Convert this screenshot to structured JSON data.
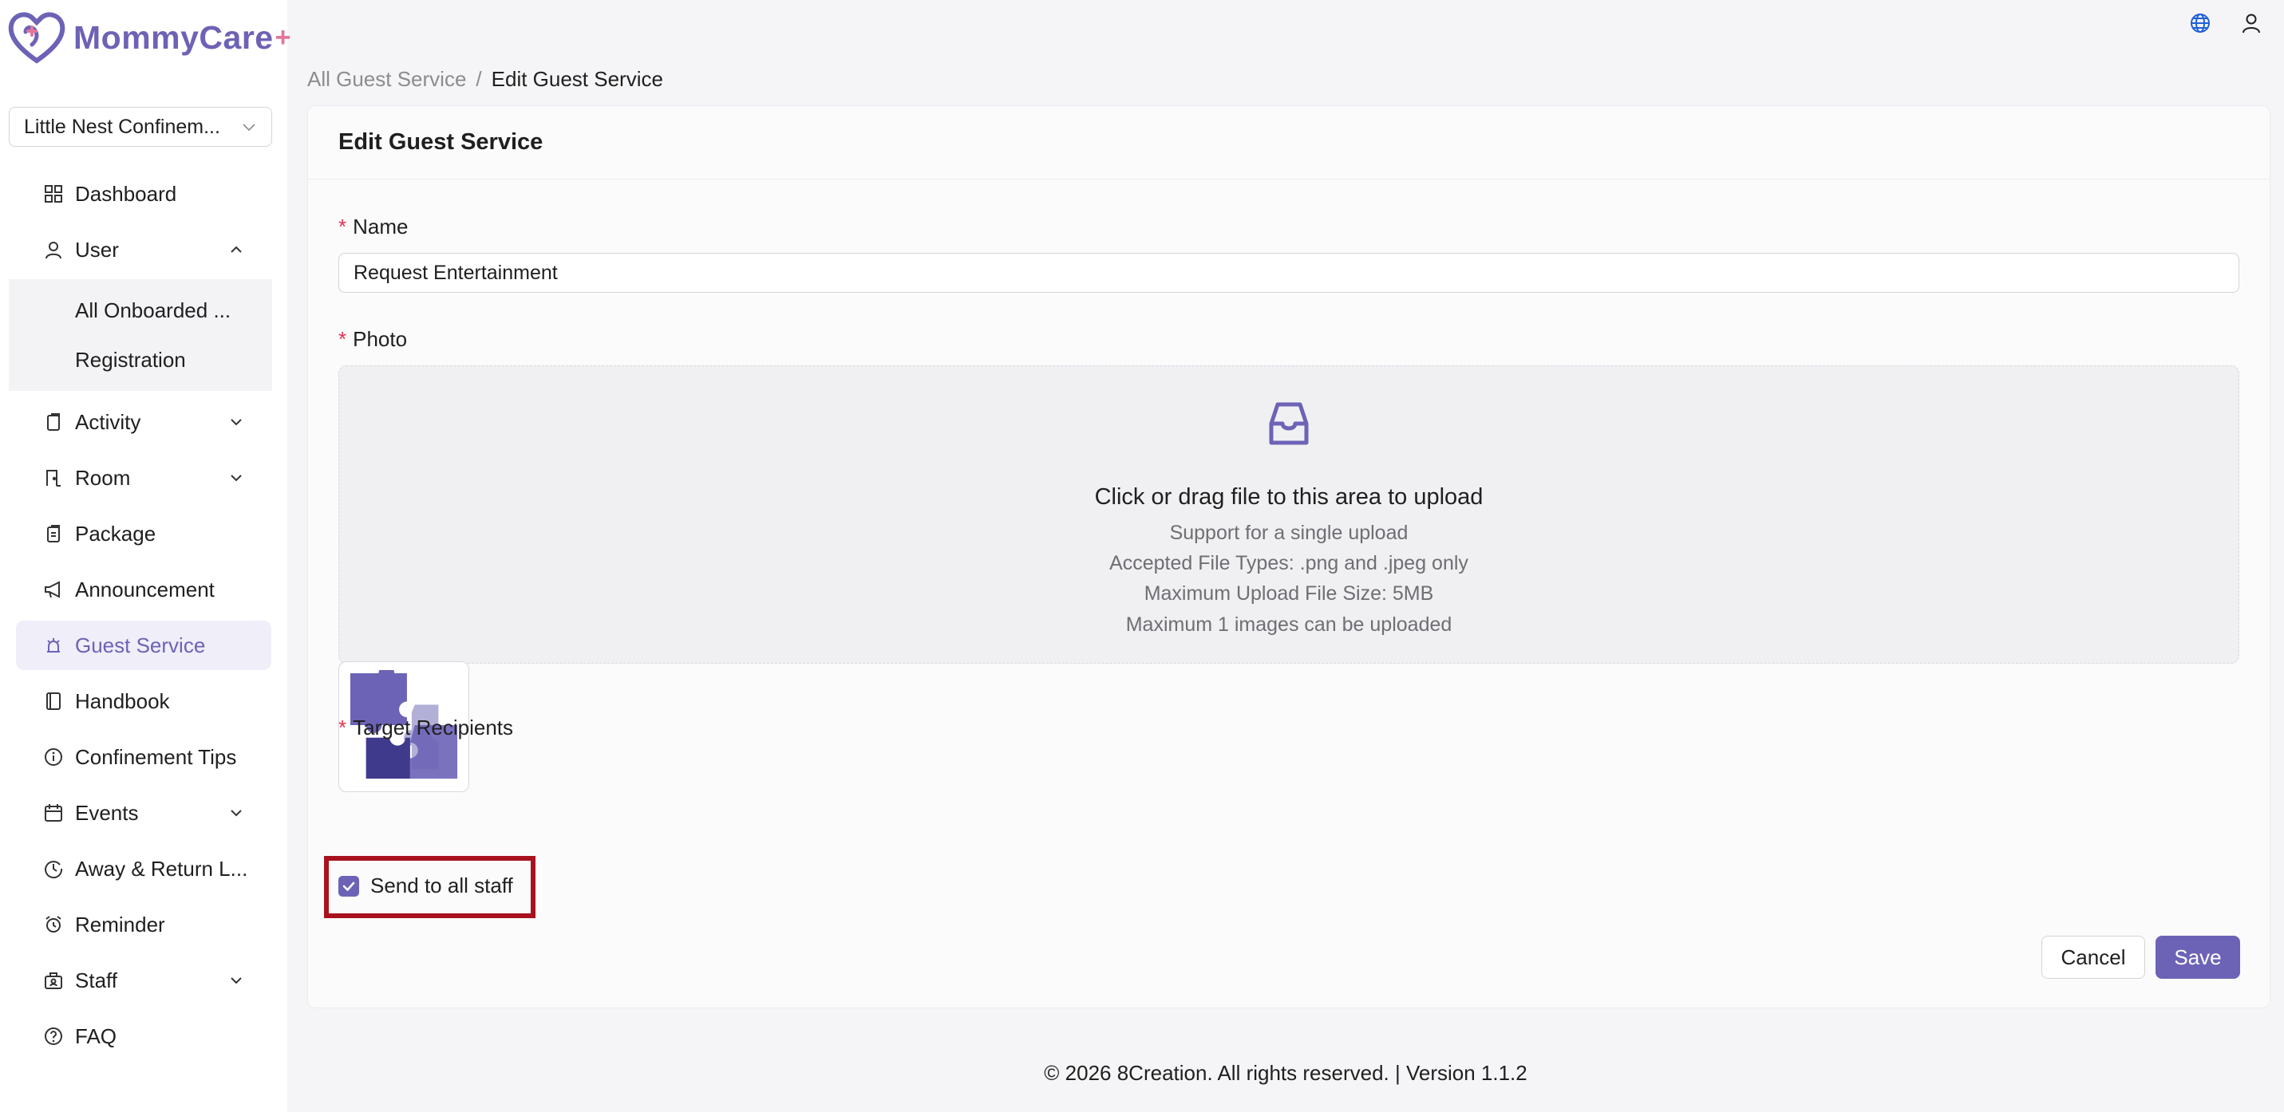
{
  "brand": {
    "name": "MommyCare",
    "plus": "+",
    "primary_color": "#6c63b6",
    "accent_color": "#e0769c"
  },
  "org_select": {
    "value": "Little Nest Confinem..."
  },
  "sidebar": {
    "items": [
      {
        "label": "Dashboard",
        "icon": "dashboard-icon"
      },
      {
        "label": "User",
        "icon": "user-icon",
        "expanded": true,
        "children": [
          {
            "label": "All Onboarded ..."
          },
          {
            "label": "Registration"
          }
        ]
      },
      {
        "label": "Activity",
        "icon": "activity-icon"
      },
      {
        "label": "Room",
        "icon": "room-icon"
      },
      {
        "label": "Package",
        "icon": "package-icon"
      },
      {
        "label": "Announcement",
        "icon": "announcement-icon"
      },
      {
        "label": "Guest Service",
        "icon": "guest-service-icon",
        "active": true
      },
      {
        "label": "Handbook",
        "icon": "handbook-icon"
      },
      {
        "label": "Confinement Tips",
        "icon": "info-icon"
      },
      {
        "label": "Events",
        "icon": "calendar-icon"
      },
      {
        "label": "Away & Return L...",
        "icon": "clock-icon"
      },
      {
        "label": "Reminder",
        "icon": "alarm-icon"
      },
      {
        "label": "Staff",
        "icon": "staff-icon"
      },
      {
        "label": "FAQ",
        "icon": "question-icon"
      }
    ]
  },
  "breadcrumb": {
    "parent": "All Guest Service",
    "separator": "/",
    "current": "Edit Guest Service"
  },
  "form": {
    "title": "Edit Guest Service",
    "name_label": "Name",
    "name_value": "Request Entertainment",
    "photo_label": "Photo",
    "upload": {
      "title": "Click or drag file to this area to upload",
      "lines": [
        "Support for a single upload",
        "Accepted File Types: .png and .jpeg only",
        "Maximum Upload File Size: 5MB",
        "Maximum 1 images can be uploaded"
      ]
    },
    "recipients_label": "Target Recipients",
    "send_all_label": "Send to all staff",
    "send_all_checked": true,
    "cancel_label": "Cancel",
    "save_label": "Save"
  },
  "required_mark": "*",
  "footer": {
    "text": "© 2026 8Creation. All rights reserved. | Version 1.1.2"
  }
}
